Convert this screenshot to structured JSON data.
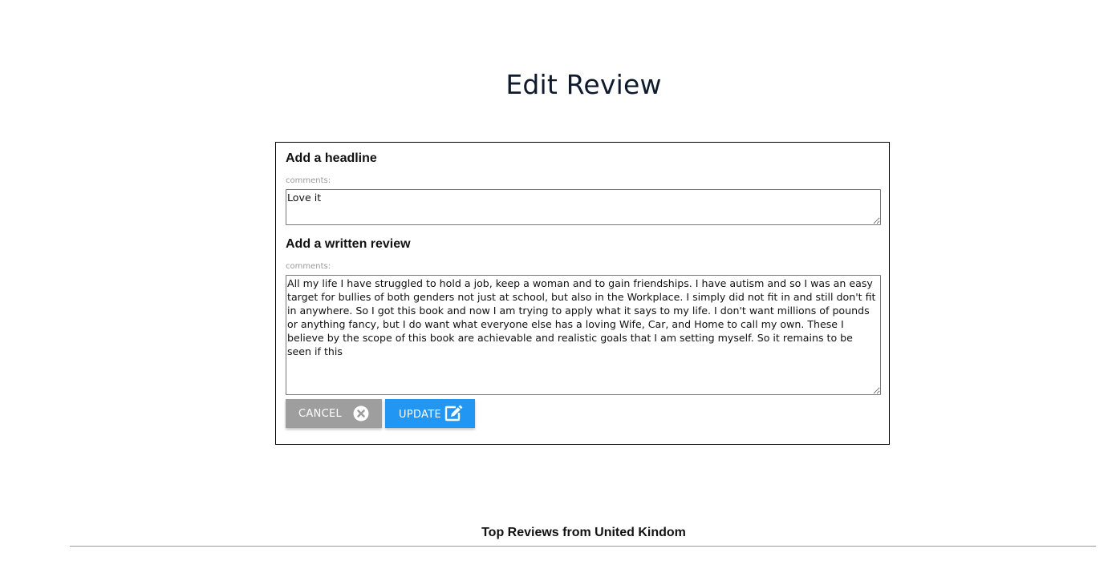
{
  "page": {
    "title": "Edit Review"
  },
  "form": {
    "headline": {
      "heading": "Add a headline",
      "caption": "comments:",
      "value": "Love it"
    },
    "review": {
      "heading": "Add a written review",
      "caption": "comments:",
      "value": "All my life I have struggled to hold a job, keep a woman and to gain friendships. I have autism and so I was an easy target for bullies of both genders not just at school, but also in the Workplace. I simply did not fit in and still don't fit in anywhere. So I got this book and now I am trying to apply what it says to my life. I don't want millions of pounds or anything fancy, but I do want what everyone else has a loving Wife, Car, and Home to call my own. These I believe by the scope of this book are achievable and realistic goals that I am setting myself. So it remains to be seen if this"
    },
    "buttons": {
      "cancel_label": "CANCEL",
      "cancel_icon": "close-circle-icon",
      "update_label": "UPDATE",
      "update_icon": "edit-icon"
    }
  },
  "reviews_section": {
    "title": "Top Reviews from United Kindom"
  },
  "colors": {
    "cancel_button": "#9e9e9e",
    "update_button": "#2196f3",
    "title_text": "#0f1b2c"
  }
}
